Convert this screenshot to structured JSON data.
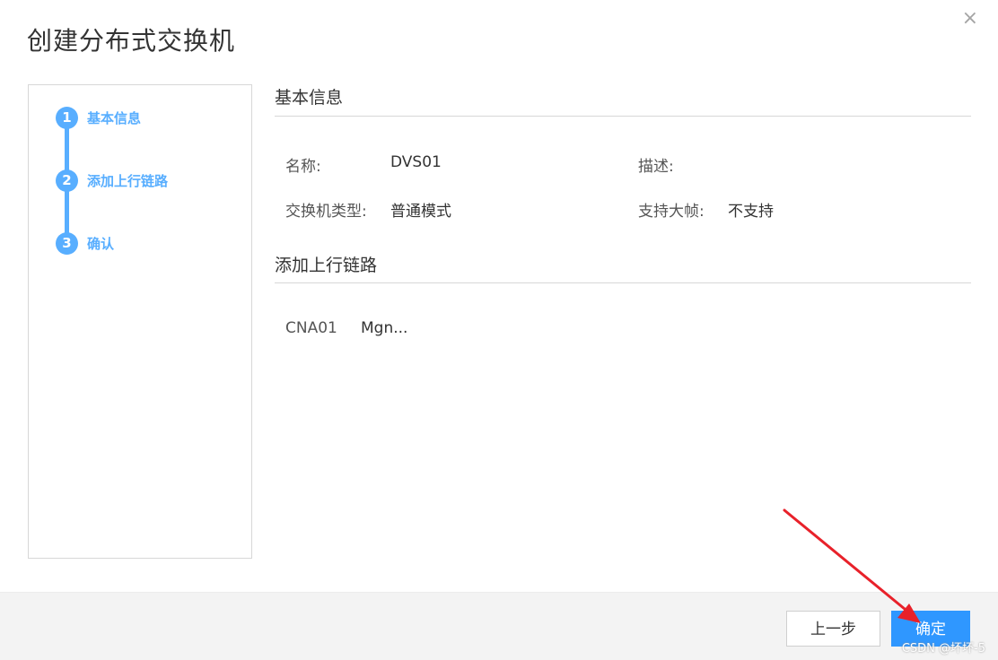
{
  "dialog": {
    "title": "创建分布式交换机",
    "close_glyph": "×"
  },
  "steps": [
    {
      "num": "1",
      "label": "基本信息"
    },
    {
      "num": "2",
      "label": "添加上行链路"
    },
    {
      "num": "3",
      "label": "确认"
    }
  ],
  "basic": {
    "title": "基本信息",
    "name_label": "名称:",
    "name_value": "DVS01",
    "desc_label": "描述:",
    "desc_value": "",
    "type_label": "交换机类型:",
    "type_value": "普通模式",
    "jumbo_label": "支持大帧:",
    "jumbo_value": "不支持"
  },
  "uplink": {
    "title": "添加上行链路",
    "host": "CNA01",
    "port": "Mgn..."
  },
  "footer": {
    "prev_label": "上一步",
    "ok_label": "确定",
    "watermark": "CSDN @坏坏-5"
  },
  "colors": {
    "accent": "#58aeff",
    "primary_button": "#2f97ff",
    "annotation_arrow": "#e8212a"
  }
}
